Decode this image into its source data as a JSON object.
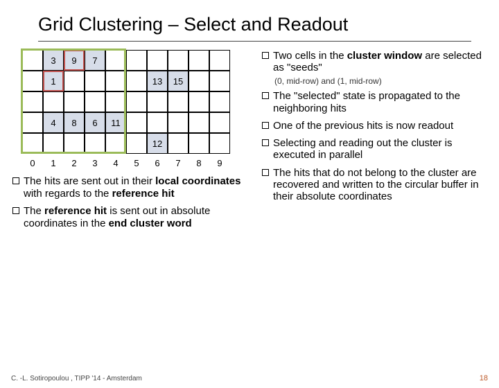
{
  "title": "Grid Clustering – Select and Readout",
  "grid": {
    "rows": 5,
    "cols": 10,
    "cell_size": 30,
    "col_labels": [
      "0",
      "1",
      "2",
      "3",
      "4",
      "5",
      "6",
      "7",
      "8",
      "9"
    ],
    "cells": [
      {
        "r": 0,
        "c": 1,
        "val": "3",
        "filled": true,
        "red": false
      },
      {
        "r": 0,
        "c": 2,
        "val": "9",
        "filled": true,
        "red": true
      },
      {
        "r": 0,
        "c": 3,
        "val": "7",
        "filled": true,
        "red": false
      },
      {
        "r": 1,
        "c": 1,
        "val": "1",
        "filled": true,
        "red": true
      },
      {
        "r": 1,
        "c": 6,
        "val": "13",
        "filled": true,
        "red": false
      },
      {
        "r": 1,
        "c": 7,
        "val": "15",
        "filled": true,
        "red": false
      },
      {
        "r": 3,
        "c": 1,
        "val": "4",
        "filled": true,
        "red": false
      },
      {
        "r": 3,
        "c": 2,
        "val": "8",
        "filled": true,
        "red": false
      },
      {
        "r": 3,
        "c": 3,
        "val": "6",
        "filled": true,
        "red": false
      },
      {
        "r": 3,
        "c": 4,
        "val": "11",
        "filled": true,
        "red": false
      },
      {
        "r": 4,
        "c": 6,
        "val": "12",
        "filled": true,
        "red": false
      }
    ],
    "cluster_window": {
      "r": 0,
      "c": 0,
      "w": 5,
      "h": 5
    }
  },
  "right_bullets": [
    {
      "prefix": "Two cells in the ",
      "b1": "cluster window",
      "mid": " are selected as \"seeds\"",
      "sub": "(0, mid-row) and (1, mid-row)"
    },
    {
      "text_a": "The \"selected\" state is propagated to the neighboring hits"
    },
    {
      "text_a": "One of the previous hits is now readout"
    },
    {
      "text_a": "Selecting and reading out the cluster is executed in parallel"
    },
    {
      "text_a": "The hits that do not belong to the cluster are recovered and written to the circular buffer in their absolute coordinates"
    }
  ],
  "left_bullets": [
    {
      "a": "The hits are sent out in their ",
      "b": "local coordinates",
      "c": " with regards to the ",
      "d": "reference hit"
    },
    {
      "a": "The ",
      "b": "reference hit",
      "c": " is sent out in absolute coordinates in the ",
      "d": "end cluster word"
    }
  ],
  "footer": "C. -L. Sotiropoulou , TIPP '14 - Amsterdam",
  "page_number": "18"
}
